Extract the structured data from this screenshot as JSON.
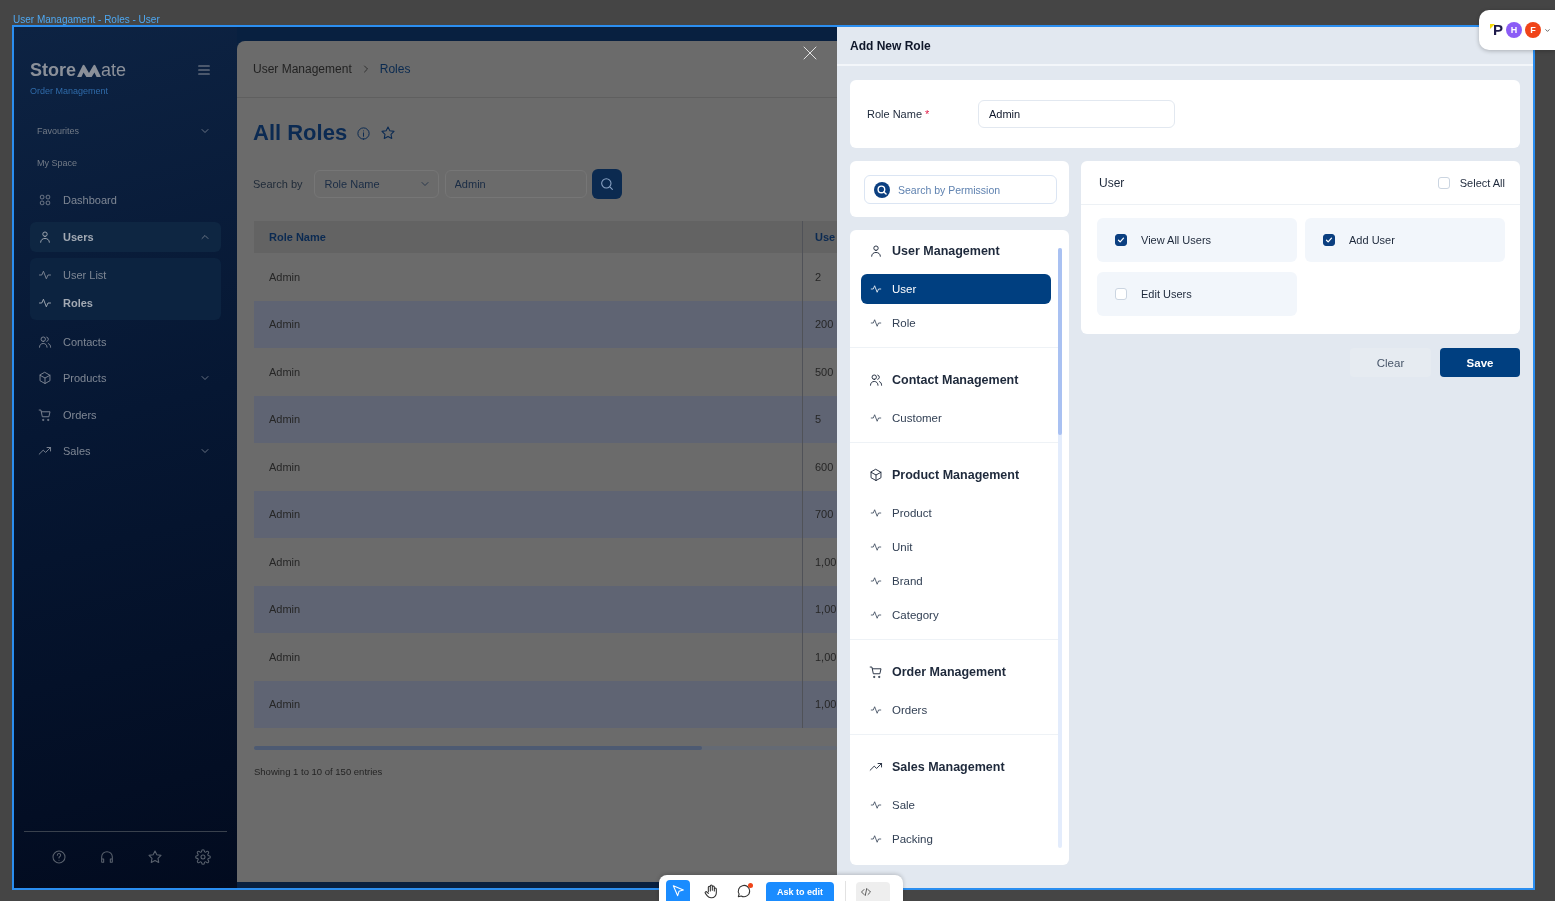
{
  "window": {
    "title": "User Managament - Roles - User"
  },
  "sidebar": {
    "logo": {
      "prefix": "Store",
      "suffix": "ate"
    },
    "subtitle": "Order Management",
    "sections": [
      {
        "label": "Favourites",
        "kind": "group",
        "expanded": false
      },
      {
        "label": "My Space",
        "kind": "label"
      }
    ],
    "nav": [
      {
        "label": "Dashboard",
        "kind": "link",
        "selected": false
      },
      {
        "label": "Users",
        "kind": "group",
        "selected": true,
        "expanded": true,
        "children": [
          {
            "label": "User List",
            "selected": false
          },
          {
            "label": "Roles",
            "selected": true
          }
        ]
      },
      {
        "label": "Contacts",
        "kind": "link",
        "selected": false
      },
      {
        "label": "Products",
        "kind": "group",
        "selected": false,
        "expanded": false
      },
      {
        "label": "Orders",
        "kind": "link",
        "selected": false
      },
      {
        "label": "Sales",
        "kind": "group",
        "selected": false,
        "expanded": false
      }
    ]
  },
  "main": {
    "breadcrumb": [
      "User Management",
      "Roles"
    ],
    "title": "All Roles",
    "search": {
      "label": "Search by",
      "field": "Role Name",
      "value": "Admin"
    },
    "table": {
      "columns": [
        "Role Name",
        "Use"
      ],
      "rows": [
        [
          "Admin",
          "2"
        ],
        [
          "Admin",
          "200"
        ],
        [
          "Admin",
          "500"
        ],
        [
          "Admin",
          "5"
        ],
        [
          "Admin",
          "600"
        ],
        [
          "Admin",
          "700"
        ],
        [
          "Admin",
          "1,00"
        ],
        [
          "Admin",
          "1,00"
        ],
        [
          "Admin",
          "1,00"
        ],
        [
          "Admin",
          "1,00"
        ]
      ]
    },
    "footer": "Showing 1 to 10 of 150 entries"
  },
  "drawer": {
    "title": "Add New Role",
    "role_name": {
      "label": "Role Name",
      "required_mark": "*",
      "value": "Admin"
    },
    "permission_search": {
      "placeholder": "Search by Permission"
    },
    "groups": [
      {
        "title": "User Management",
        "items": [
          {
            "label": "User",
            "selected": true
          },
          {
            "label": "Role",
            "selected": false
          }
        ]
      },
      {
        "title": "Contact Management",
        "items": [
          {
            "label": "Customer",
            "selected": false
          }
        ]
      },
      {
        "title": "Product Management",
        "items": [
          {
            "label": "Product",
            "selected": false
          },
          {
            "label": "Unit",
            "selected": false
          },
          {
            "label": "Brand",
            "selected": false
          },
          {
            "label": "Category",
            "selected": false
          }
        ]
      },
      {
        "title": "Order Management",
        "items": [
          {
            "label": "Orders",
            "selected": false
          }
        ]
      },
      {
        "title": "Sales Management",
        "items": [
          {
            "label": "Sale",
            "selected": false
          },
          {
            "label": "Packing",
            "selected": false
          }
        ]
      }
    ],
    "permissions": {
      "title": "User",
      "select_all": {
        "label": "Select All",
        "checked": false
      },
      "items": [
        {
          "label": "View All Users",
          "checked": true
        },
        {
          "label": "Add User",
          "checked": true
        },
        {
          "label": "Edit Users",
          "checked": false
        }
      ]
    },
    "buttons": [
      {
        "label": "Clear",
        "kind": "secondary"
      },
      {
        "label": "Save",
        "kind": "primary"
      }
    ]
  },
  "presence": {
    "logo": "P",
    "avatars": [
      {
        "initial": "H",
        "color": "#8b5cf6"
      },
      {
        "initial": "F",
        "color": "#f04418"
      }
    ]
  },
  "toolbar": {
    "tools": [
      {
        "selected": true
      },
      {
        "selected": false
      },
      {
        "selected": false
      }
    ],
    "ask_button": "Ask to edit"
  }
}
